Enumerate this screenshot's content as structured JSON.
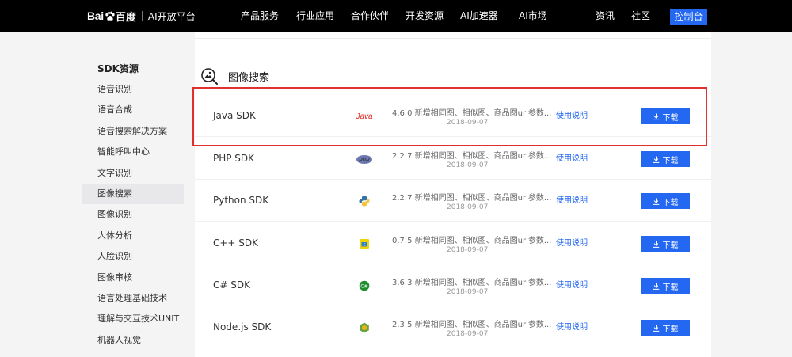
{
  "header": {
    "logo_bai": "Bai",
    "logo_du": "百度",
    "logo_ai": "AI开放平台",
    "nav": [
      "产品服务",
      "行业应用",
      "合作伙伴",
      "开发资源",
      "AI加速器",
      "AI市场"
    ],
    "right_links": [
      "资讯",
      "社区"
    ],
    "console_label": "控制台"
  },
  "sidebar": {
    "title": "SDK资源",
    "items": [
      {
        "label": "语音识别"
      },
      {
        "label": "语音合成"
      },
      {
        "label": "语音搜索解决方案"
      },
      {
        "label": "智能呼叫中心"
      },
      {
        "label": "文字识别"
      },
      {
        "label": "图像搜索",
        "active": true
      },
      {
        "label": "图像识别"
      },
      {
        "label": "人体分析"
      },
      {
        "label": "人脸识别"
      },
      {
        "label": "图像审核"
      },
      {
        "label": "语言处理基础技术"
      },
      {
        "label": "理解与交互技术UNIT"
      },
      {
        "label": "机器人视觉"
      }
    ]
  },
  "main": {
    "section_title": "图像搜索",
    "doc_label": "使用说明",
    "download_label": "下载",
    "rows": [
      {
        "name": "Java SDK",
        "icon": "java-icon",
        "icon_text": "Java",
        "desc": "4.6.0 新增相同图、相似图、商品图url参数...",
        "date": "2018-09-07"
      },
      {
        "name": "PHP SDK",
        "icon": "php-icon",
        "icon_text": "php",
        "desc": "2.2.7 新增相同图、相似图、商品图url参数...",
        "date": "2018-09-07"
      },
      {
        "name": "Python SDK",
        "icon": "python-icon",
        "desc": "2.2.7 新增相同图、相似图、商品图url参数...",
        "date": "2018-09-07"
      },
      {
        "name": "C++ SDK",
        "icon": "cpp-icon",
        "desc": "0.7.5 新增相同图、相似图、商品图url参数...",
        "date": "2018-09-07"
      },
      {
        "name": "C# SDK",
        "icon": "csharp-icon",
        "desc": "3.6.3 新增相同图、相似图、商品图url参数...",
        "date": "2018-09-07"
      },
      {
        "name": "Node.js SDK",
        "icon": "nodejs-icon",
        "desc": "2.3.5 新增相同图、相似图、商品图url参数...",
        "date": "2018-09-07"
      }
    ]
  },
  "colors": {
    "accent": "#2468f2",
    "highlight": "#e0302e",
    "java": "#e2231a"
  }
}
